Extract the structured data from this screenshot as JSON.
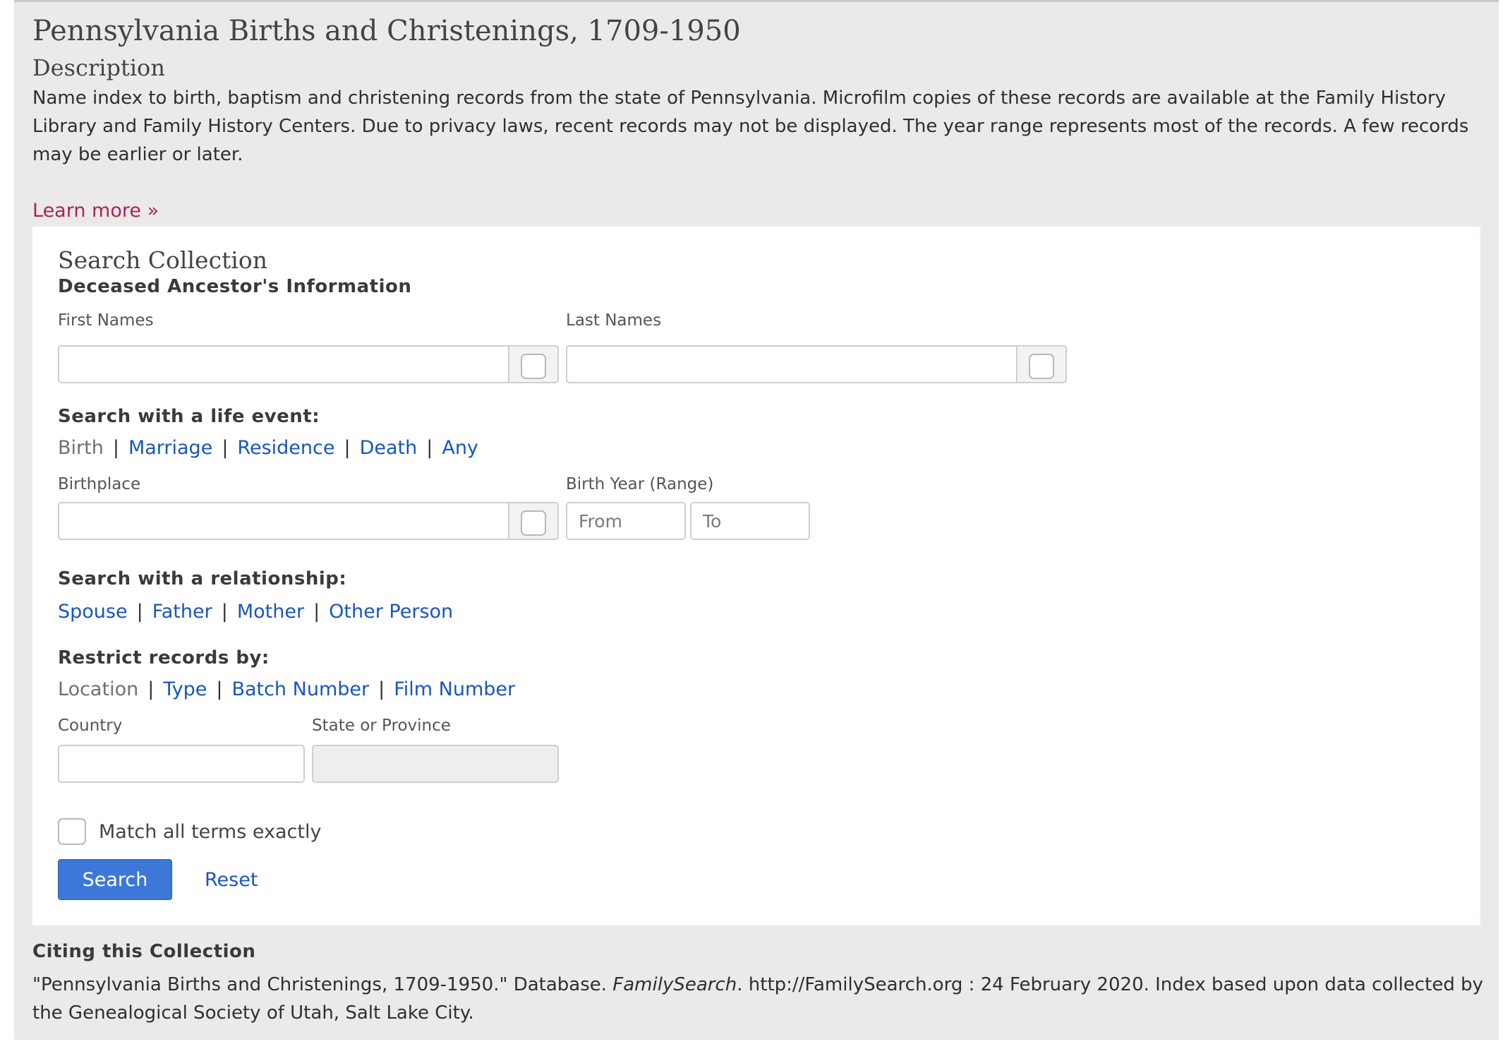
{
  "page": {
    "title": "Pennsylvania Births and Christenings, 1709-1950",
    "description_heading": "Description",
    "description_text": "Name index to birth, baptism and christening records from the state of Pennsylvania. Microfilm copies of these records are available at the Family History Library and Family History Centers. Due to privacy laws, recent records may not be displayed. The year range represents most of the records. A few records may be earlier or later.",
    "learn_more": "Learn more »"
  },
  "search": {
    "heading": "Search Collection",
    "ancestor_heading": "Deceased Ancestor's Information",
    "first_names_label": "First Names",
    "first_names_value": "",
    "last_names_label": "Last Names",
    "last_names_value": "",
    "life_event_heading": "Search with a life event:",
    "life_events": [
      "Birth",
      "Marriage",
      "Residence",
      "Death",
      "Any"
    ],
    "life_event_selected": "Birth",
    "birthplace_label": "Birthplace",
    "birthplace_value": "",
    "birth_year_label": "Birth Year (Range)",
    "from_placeholder": "From",
    "to_placeholder": "To",
    "relationship_heading": "Search with a relationship:",
    "relationships": [
      "Spouse",
      "Father",
      "Mother",
      "Other Person"
    ],
    "restrict_heading": "Restrict records by:",
    "restrict_options": [
      "Location",
      "Type",
      "Batch Number",
      "Film Number"
    ],
    "restrict_selected": "Location",
    "country_label": "Country",
    "country_value": "",
    "state_label": "State or Province",
    "state_value": "",
    "match_exact_label": "Match all terms exactly",
    "match_exact_checked": false,
    "search_button": "Search",
    "reset_link": "Reset"
  },
  "citation": {
    "heading": "Citing this Collection",
    "text_before": "\"Pennsylvania Births and Christenings, 1709-1950.\" Database. ",
    "text_italic": "FamilySearch",
    "text_after": ". http://FamilySearch.org : 24 February 2020. Index based upon data collected by the Genealogical Society of Utah, Salt Lake City."
  },
  "colors": {
    "page_bg": "#ebeae9",
    "link_blue": "#1a56b8",
    "learn_more_magenta": "#a8245c",
    "button_blue": "#3d78d8"
  }
}
